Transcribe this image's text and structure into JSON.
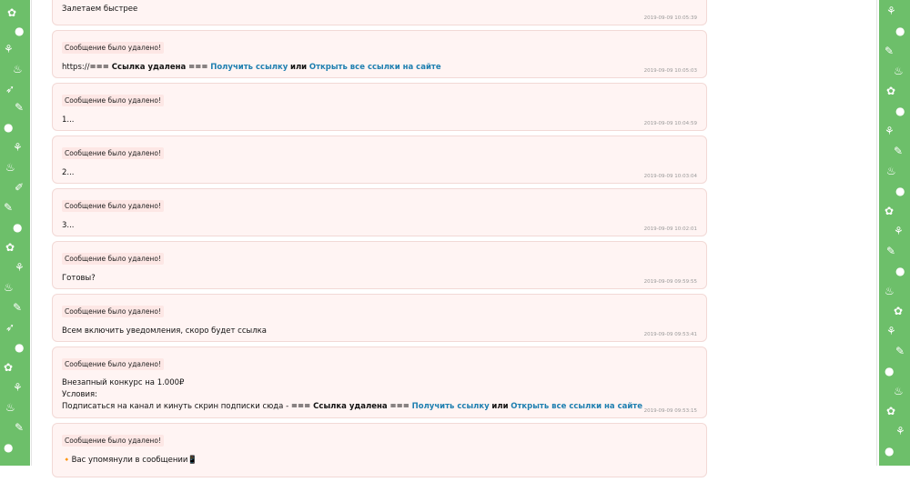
{
  "deleted_label": "Сообщение было удалено!",
  "link_removed": "=== Ссылка удалена ===",
  "get_link": "Получить ссылку",
  "or": "или",
  "open_all_links": "Открыть все ссылки на сайте",
  "posts": [
    {
      "text": "Залетаем быстрее",
      "time": "2019-09-09 10:05:39"
    },
    {
      "prefix": "https://",
      "time": "2019-09-09 10:05:03"
    },
    {
      "text": "1...",
      "time": "2019-09-09 10:04:59"
    },
    {
      "text": "2...",
      "time": "2019-09-09 10:03:04"
    },
    {
      "text": "3...",
      "time": "2019-09-09 10:02:01"
    },
    {
      "text": "Готовы?",
      "time": "2019-09-09 09:59:55"
    },
    {
      "text": "Всем включить уведомления, скоро будет ссылка",
      "time": "2019-09-09 09:53:41"
    },
    {
      "line1": "Внезапный конкурс на 1.000₽",
      "line2": "Условия:",
      "line3_prefix": "Подписаться на канал и кинуть скрин подписки сюда - ",
      "time": "2019-09-09 09:53:15"
    },
    {
      "text": "🔸Вас упомянули в сообщении📱"
    }
  ],
  "colors": {
    "sidebar": "#6dbf6a",
    "card_bg": "#fff4f3",
    "link": "#1e7fb0"
  }
}
